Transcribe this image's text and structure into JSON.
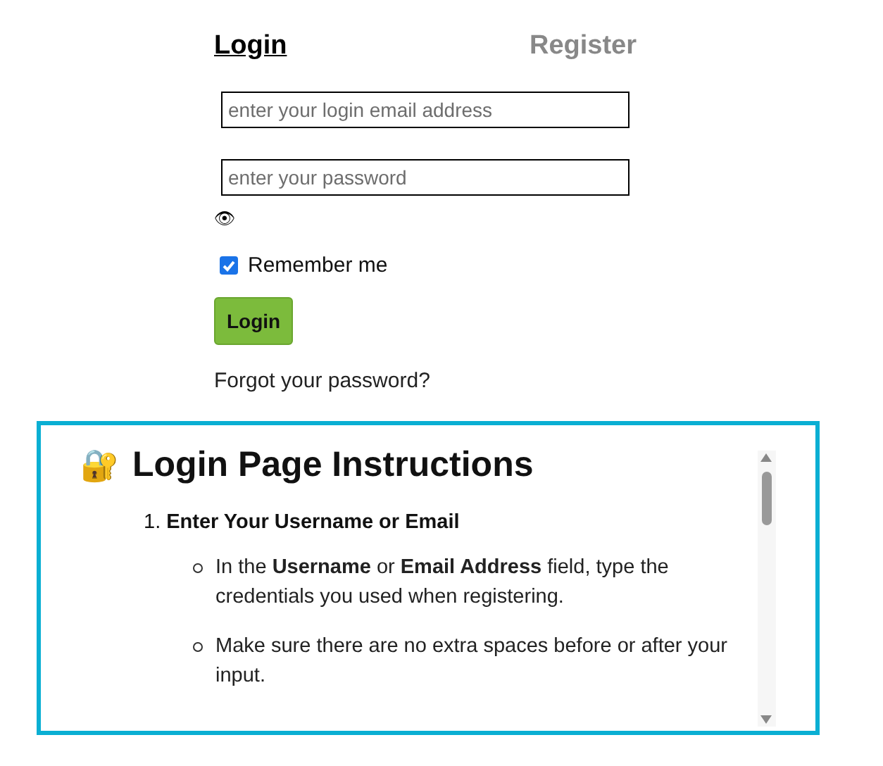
{
  "tabs": [
    {
      "label": "Login",
      "selected": true
    },
    {
      "label": "Register",
      "selected": false
    }
  ],
  "form": {
    "email": {
      "placeholder": "enter your login email address"
    },
    "password": {
      "placeholder": "enter your password"
    },
    "show_password": "👁",
    "remember": {
      "label": "Remember me",
      "checked": true
    },
    "submit": "Login",
    "forgot": "Forgot your password?"
  },
  "instructions": {
    "icon": "🔐",
    "title": "Login Page Instructions",
    "steps": [
      {
        "number": "1.",
        "title": "Enter Your Username or Email",
        "points": [
          "In the **Username** or **Email Address** field, type the credentials you used when registering.",
          "Make sure there are no extra spaces before or after your input."
        ]
      }
    ]
  }
}
